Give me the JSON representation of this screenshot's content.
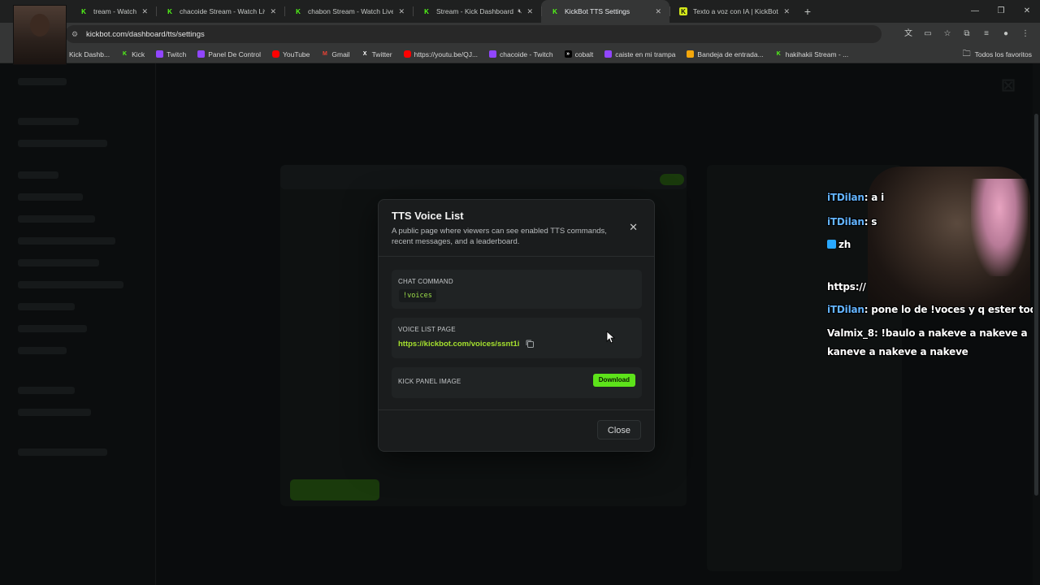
{
  "browser": {
    "tabs": [
      {
        "title": "tream - Watch Live o",
        "icon": "kick",
        "active": false
      },
      {
        "title": "chacoide Stream - Watch Live o",
        "icon": "kick",
        "active": false
      },
      {
        "title": "chabon Stream - Watch Live on",
        "icon": "kick",
        "active": false
      },
      {
        "title": "Stream - Kick Dashboard",
        "icon": "kick",
        "active": false,
        "muted": true
      },
      {
        "title": "KickBot TTS Settings",
        "icon": "kick",
        "active": true
      },
      {
        "title": "Texto a voz con IA | KickBot",
        "icon": "kickbot",
        "active": false
      }
    ],
    "url": "kickbot.com/dashboard/tts/settings",
    "bookmarks": [
      "Kick Dashb...",
      "Kick",
      "Twitch",
      "Panel De Control",
      "YouTube",
      "Gmail",
      "Twitter",
      "https://youtu.be/QJ...",
      "chacoide - Twitch",
      "cobalt",
      "caiste en mi trampa",
      "Bandeja de entrada...",
      "hakihakii Stream - ..."
    ],
    "bookmarks_right": "Todos los favoritos"
  },
  "modal": {
    "title": "TTS Voice List",
    "description": "A public page where viewers can see enabled TTS commands, recent messages, and a leaderboard.",
    "chat_command": {
      "label": "CHAT COMMAND",
      "value": "!voices"
    },
    "voice_list_page": {
      "label": "VOICE LIST PAGE",
      "url": "https://kickbot.com/voices/ssnt1i"
    },
    "kick_panel_image": {
      "label": "KICK PANEL IMAGE",
      "button": "Download"
    },
    "close_button": "Close"
  },
  "stream_chat": [
    {
      "name": "iTDilan",
      "text": ": a i"
    },
    {
      "name": "iTDilan",
      "text": ": s"
    },
    {
      "name": "",
      "text": "zh"
    },
    {
      "name": "",
      "text": "https://"
    },
    {
      "name": "iTDilan",
      "text": ": pone lo de !voces y q ester todos"
    },
    {
      "name": "Valmix_8",
      "text": ": !baulo a nakeve a nakeve a"
    },
    {
      "name": "",
      "text": "kaneve a nakeve a nakeve"
    }
  ],
  "colors": {
    "accent": "#5de31a",
    "link": "#a6e22e",
    "modal_bg": "#1a1c1d"
  }
}
